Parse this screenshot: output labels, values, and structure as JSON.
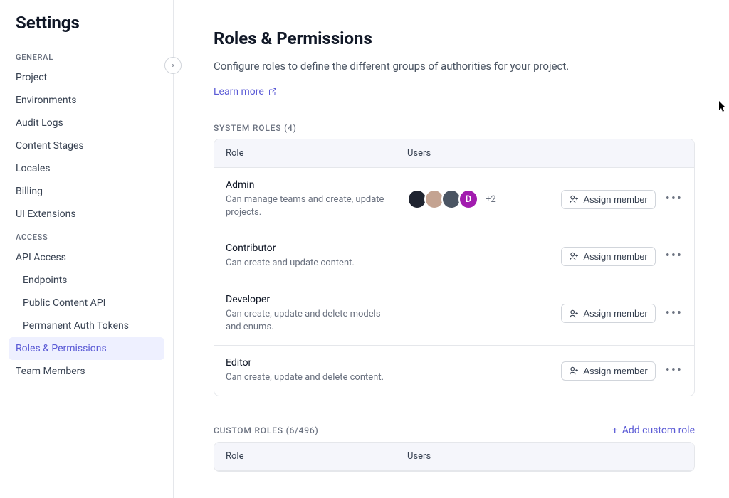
{
  "sidebar": {
    "title": "Settings",
    "sections": [
      {
        "label": "GENERAL",
        "items": [
          "Project",
          "Environments",
          "Audit Logs",
          "Content Stages",
          "Locales",
          "Billing",
          "UI Extensions"
        ]
      },
      {
        "label": "ACCESS",
        "items": [
          {
            "text": "API Access",
            "indent": false
          },
          {
            "text": "Endpoints",
            "indent": true
          },
          {
            "text": "Public Content API",
            "indent": true
          },
          {
            "text": "Permanent Auth Tokens",
            "indent": true
          },
          {
            "text": "Roles & Permissions",
            "indent": false,
            "active": true
          },
          {
            "text": "Team Members",
            "indent": false
          }
        ]
      }
    ]
  },
  "main": {
    "title": "Roles & Permissions",
    "description": "Configure roles to define the different groups of authorities for your project.",
    "learn_more": "Learn more",
    "system_roles_header": "SYSTEM ROLES (4)",
    "custom_roles_header": "CUSTOM ROLES (6/496)",
    "add_custom_label": "Add custom role",
    "columns": {
      "role": "Role",
      "users": "Users"
    },
    "assign_label": "Assign member",
    "system_roles": [
      {
        "name": "Admin",
        "desc": "Can manage teams and create, update projects.",
        "users": [
          {
            "bg": "#1f2430"
          },
          {
            "bg": "#c4a391"
          },
          {
            "bg": "#4b5563"
          },
          {
            "bg": "#a21caf",
            "letter": "D"
          }
        ],
        "more": "+2"
      },
      {
        "name": "Contributor",
        "desc": "Can create and update content.",
        "users": [],
        "more": ""
      },
      {
        "name": "Developer",
        "desc": "Can create, update and delete models and enums.",
        "users": [],
        "more": ""
      },
      {
        "name": "Editor",
        "desc": "Can create, update and delete content.",
        "users": [],
        "more": ""
      }
    ]
  }
}
